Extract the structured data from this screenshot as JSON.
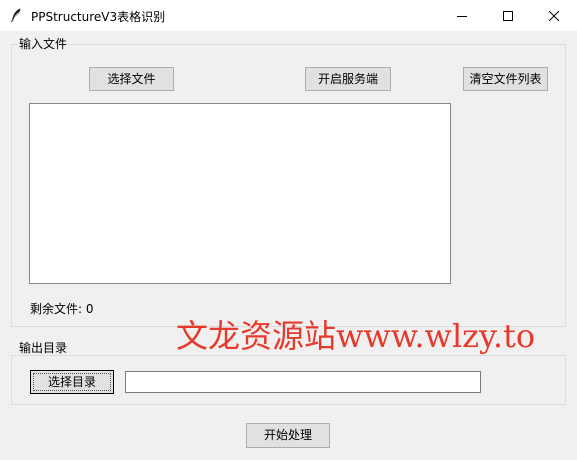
{
  "window": {
    "title": "PPStructureV3表格识别",
    "app_icon": "feather-icon",
    "controls": [
      "minimize-icon",
      "maximize-icon",
      "close-icon"
    ]
  },
  "input_group": {
    "label": "输入文件",
    "select_file_label": "选择文件",
    "start_service_label": "开启服务端",
    "clear_list_label": "清空文件列表",
    "file_list": [],
    "remaining_text": "剩余文件: 0"
  },
  "output_group": {
    "label": "输出目录",
    "select_dir_label": "选择目录",
    "dir_value": ""
  },
  "start_process_label": "开始处理",
  "watermark": {
    "text": "文龙资源站www.wlzy.to",
    "color": "#e53a2c"
  }
}
